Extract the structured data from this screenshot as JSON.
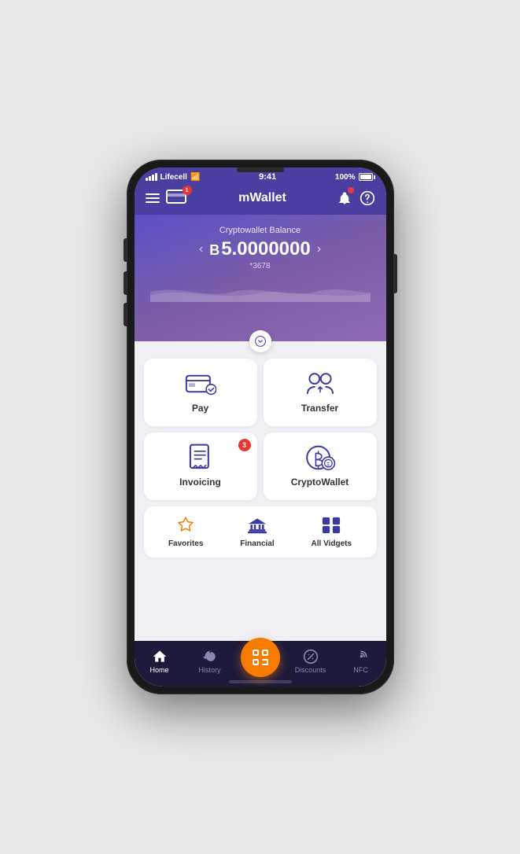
{
  "status_bar": {
    "carrier": "Lifecell",
    "time": "9:41",
    "battery": "100%"
  },
  "header": {
    "title": "mWallet",
    "card_badge": "1"
  },
  "balance": {
    "label": "Cryptowallet Balance",
    "currency_symbol": "в",
    "amount": "5.0000000",
    "account_mask": "*3678"
  },
  "actions": [
    {
      "id": "pay",
      "label": "Pay",
      "badge": null
    },
    {
      "id": "transfer",
      "label": "Transfer",
      "badge": null
    },
    {
      "id": "invoicing",
      "label": "Invoicing",
      "badge": "3"
    },
    {
      "id": "cryptowallet",
      "label": "CryptoWallet",
      "badge": null
    }
  ],
  "widgets": [
    {
      "id": "favorites",
      "label": "Favorites",
      "color": "#f57c00"
    },
    {
      "id": "financial",
      "label": "Financial",
      "color": "#3d3a9e"
    },
    {
      "id": "all_vidgets",
      "label": "All Vidgets",
      "color": "#3d3a9e"
    }
  ],
  "bottom_nav": [
    {
      "id": "home",
      "label": "Home",
      "active": true
    },
    {
      "id": "history",
      "label": "History",
      "active": false
    },
    {
      "id": "scan",
      "label": "",
      "active": false,
      "is_scan": true
    },
    {
      "id": "discounts",
      "label": "Discounts",
      "active": false
    },
    {
      "id": "nfc",
      "label": "NFC",
      "active": false
    }
  ]
}
